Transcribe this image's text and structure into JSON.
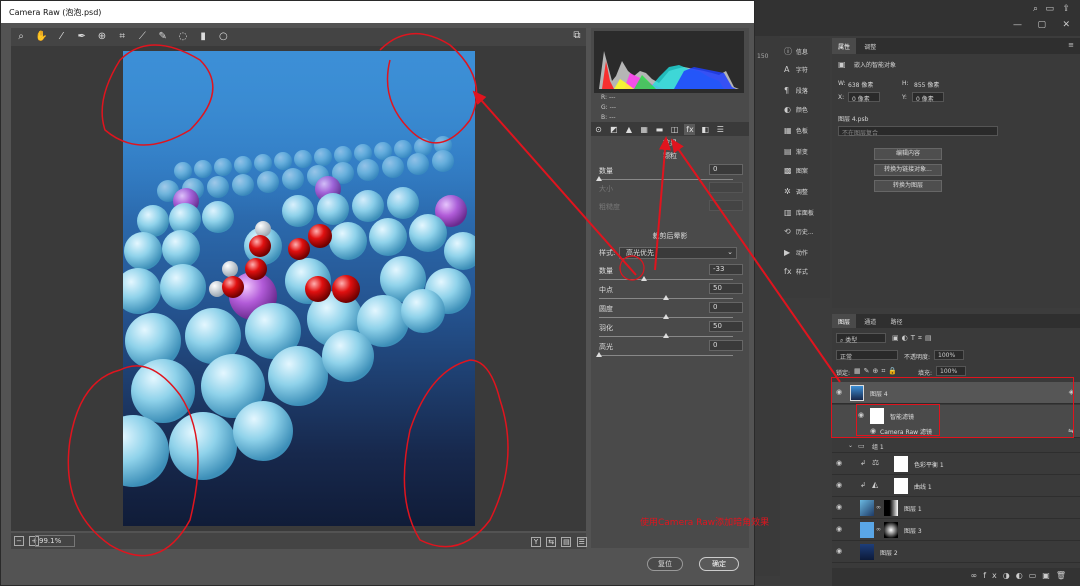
{
  "window": {
    "title": "Camera Raw (泡泡.psd)"
  },
  "toolbar": {
    "zoom_value": "99.1%"
  },
  "panel": {
    "rgb": {
      "r": "R:",
      "g": "G:",
      "b": "B:",
      "r_val": "---",
      "g_val": "---",
      "b_val": "---"
    },
    "effects_title": "效果",
    "grain": {
      "title": "颗粒",
      "amount_label": "数量",
      "amount_value": "0",
      "amount_pct": 0,
      "size_label": "大小",
      "roughness_label": "粗糙度"
    },
    "vignette": {
      "title": "裁剪后晕影",
      "style_label": "样式:",
      "style_value": "高光优先",
      "amount_label": "数量",
      "amount_value": "-33",
      "amount_pct": 0.335,
      "midpoint_label": "中点",
      "midpoint_value": "50",
      "midpoint_pct": 0.5,
      "roundness_label": "圆度",
      "roundness_value": "0",
      "roundness_pct": 0.5,
      "feather_label": "羽化",
      "feather_value": "50",
      "feather_pct": 0.5,
      "highlights_label": "高光",
      "highlights_value": "0",
      "highlights_pct": 0
    },
    "cancel_label": "复位",
    "ok_label": "确定"
  },
  "annotation": {
    "text": "使用Camera Raw添加暗角效果"
  },
  "ps": {
    "ruler_number": "150",
    "tools_column": [
      {
        "icon": "info-icon",
        "glyph": "ⓘ",
        "label": "信息"
      },
      {
        "icon": "character-icon",
        "glyph": "A",
        "label": "字符"
      },
      {
        "icon": "paragraph-icon",
        "glyph": "¶",
        "label": "段落"
      },
      {
        "icon": "color-icon",
        "glyph": "◐",
        "label": "颜色"
      },
      {
        "icon": "swatches-icon",
        "glyph": "▦",
        "label": "色板"
      },
      {
        "icon": "gradient-icon",
        "glyph": "▤",
        "label": "渐变"
      },
      {
        "icon": "pattern-icon",
        "glyph": "▩",
        "label": "图案"
      },
      {
        "icon": "adjustments-icon",
        "glyph": "✲",
        "label": "调整"
      },
      {
        "icon": "libraries-icon",
        "glyph": "▥",
        "label": "库面板"
      },
      {
        "icon": "history-icon",
        "glyph": "⟲",
        "label": "历史..."
      },
      {
        "icon": "actions-icon",
        "glyph": "▶",
        "label": "动作"
      },
      {
        "icon": "styles-icon",
        "glyph": "fx",
        "label": "样式"
      }
    ],
    "properties": {
      "tab_properties": "属性",
      "tab_adjust": "调整",
      "object_type": "嵌入的智能对象",
      "w_label": "W:",
      "w_value": "638 像素",
      "h_label": "H:",
      "h_value": "855 像素",
      "x_label": "X:",
      "x_value": "0 像素",
      "y_label": "Y:",
      "y_value": "0 像素",
      "file_name": "图层 4.psb",
      "comp_placeholder": "不在图层复合",
      "btn_edit": "编辑内容",
      "btn_convert_linked": "转换为链接对象...",
      "btn_convert_layers": "转换为图层"
    },
    "layers": {
      "tab_layers": "图层",
      "tab_channels": "通道",
      "tab_paths": "路径",
      "filter_kind": "类型",
      "blend_mode": "正常",
      "opacity_label": "不透明度:",
      "opacity_value": "100%",
      "lock_label": "锁定:",
      "fill_label": "填充:",
      "fill_value": "100%",
      "rows": [
        {
          "name": "图层 4"
        },
        {
          "name": "智能滤镜"
        },
        {
          "name": "Camera Raw 滤镜"
        },
        {
          "name": "组 1"
        },
        {
          "name": "色彩平衡 1"
        },
        {
          "name": "曲线 1"
        },
        {
          "name": "图层 1"
        },
        {
          "name": "图层 3"
        },
        {
          "name": "图层 2"
        }
      ]
    }
  }
}
